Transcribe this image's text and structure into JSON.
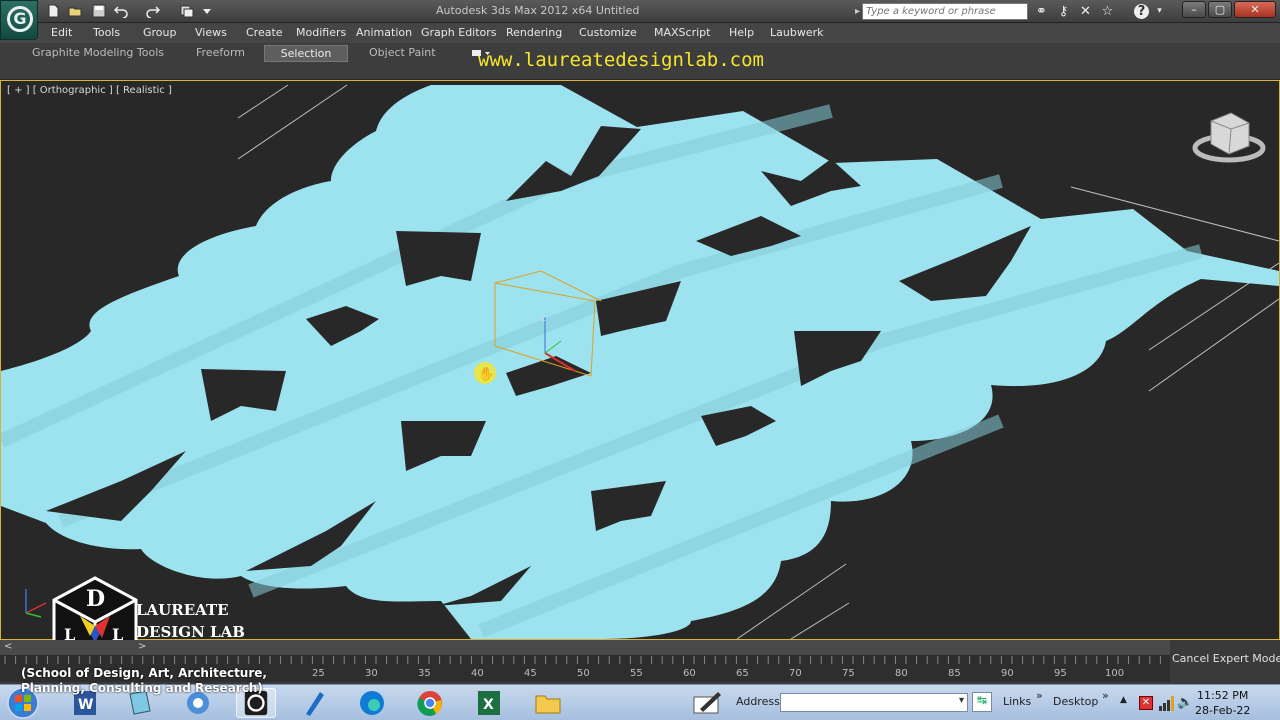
{
  "titlebar": {
    "title": "Autodesk 3ds Max 2012 x64    Untitled",
    "search_placeholder": "Type a keyword or phrase"
  },
  "menu": [
    "Edit",
    "Tools",
    "Group",
    "Views",
    "Create",
    "Modifiers",
    "Animation",
    "Graph Editors",
    "Rendering",
    "Customize",
    "MAXScript",
    "Help",
    "Laubwerk"
  ],
  "ribbon": {
    "tabs": [
      "Graphite Modeling Tools",
      "Freeform",
      "Selection",
      "Object Paint"
    ],
    "active_tab": "Selection"
  },
  "watermark": {
    "url": "www.laureatedesignlab.com",
    "lab_line1": "LAUREATE",
    "lab_line2": "DESIGN LAB",
    "sub_line1": "(School of Design, Art, Architecture,",
    "sub_line2": "Planning, Consulting and Research)",
    "logo_letters": "D L L"
  },
  "viewport": {
    "label": "[ + ] [ Orthographic ] [ Realistic ]",
    "surface_color": "#9de3ef",
    "background_color": "#282828"
  },
  "timeline": {
    "ticks": [
      "25",
      "30",
      "35",
      "40",
      "45",
      "50",
      "55",
      "60",
      "65",
      "70",
      "75",
      "80",
      "85",
      "90",
      "95",
      "100"
    ],
    "cancel_label": "Cancel Expert Mode"
  },
  "taskbar": {
    "address_label": "Address",
    "links_label": "Links",
    "desktop_label": "Desktop",
    "time": "11:52 PM",
    "date": "28-Feb-22"
  }
}
